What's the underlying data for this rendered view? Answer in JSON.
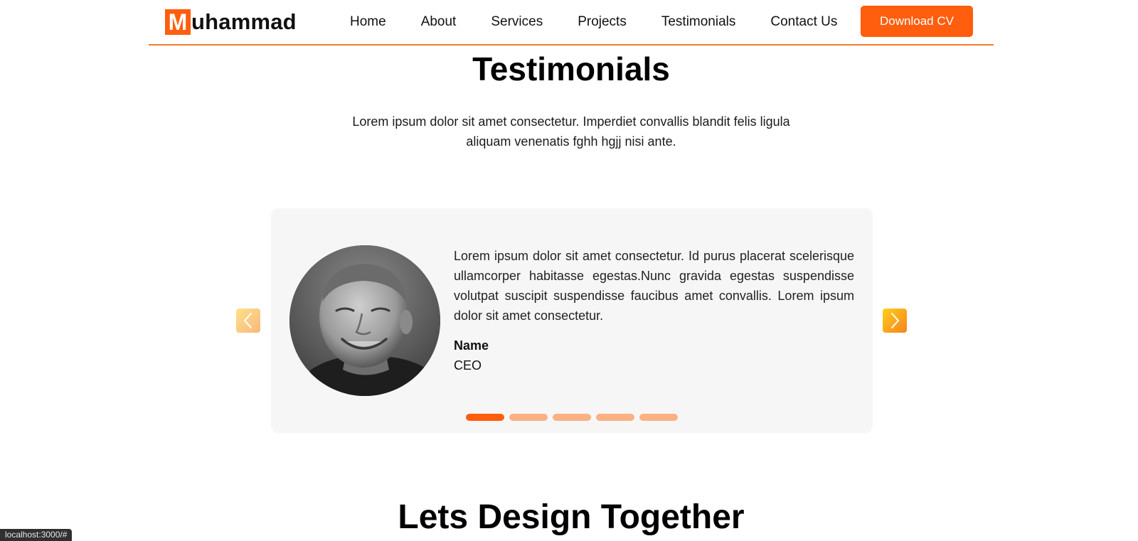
{
  "header": {
    "logo_mark": "M",
    "logo_rest": "uhammad",
    "nav": [
      "Home",
      "About",
      "Services",
      "Projects",
      "Testimonials",
      "Contact Us"
    ],
    "cv_button": "Download CV"
  },
  "testimonials": {
    "title": "Testimonials",
    "subtitle": "Lorem ipsum dolor sit amet consectetur. Imperdiet convallis blandit felis ligula aliquam venenatis fghh hgjj nisi ante.",
    "quote": "Lorem ipsum dolor sit amet consectetur. Id purus placerat scelerisque ullamcorper habitasse egestas.Nunc gravida egestas suspendisse volutpat suscipit suspendisse faucibus amet convallis. Lorem ipsum dolor sit amet consectetur.",
    "name": "Name",
    "role": "CEO",
    "slides": 5,
    "active_slide": 1,
    "prev_icon": "chevron-left-icon",
    "next_icon": "chevron-right-icon"
  },
  "next_section": {
    "title": "Lets Design Together"
  },
  "status_bar": {
    "url": "localhost:3000/#"
  },
  "colors": {
    "accent": "#ff5e0e",
    "accent_light": "#fbb183",
    "card_bg": "#f6f6f6"
  }
}
